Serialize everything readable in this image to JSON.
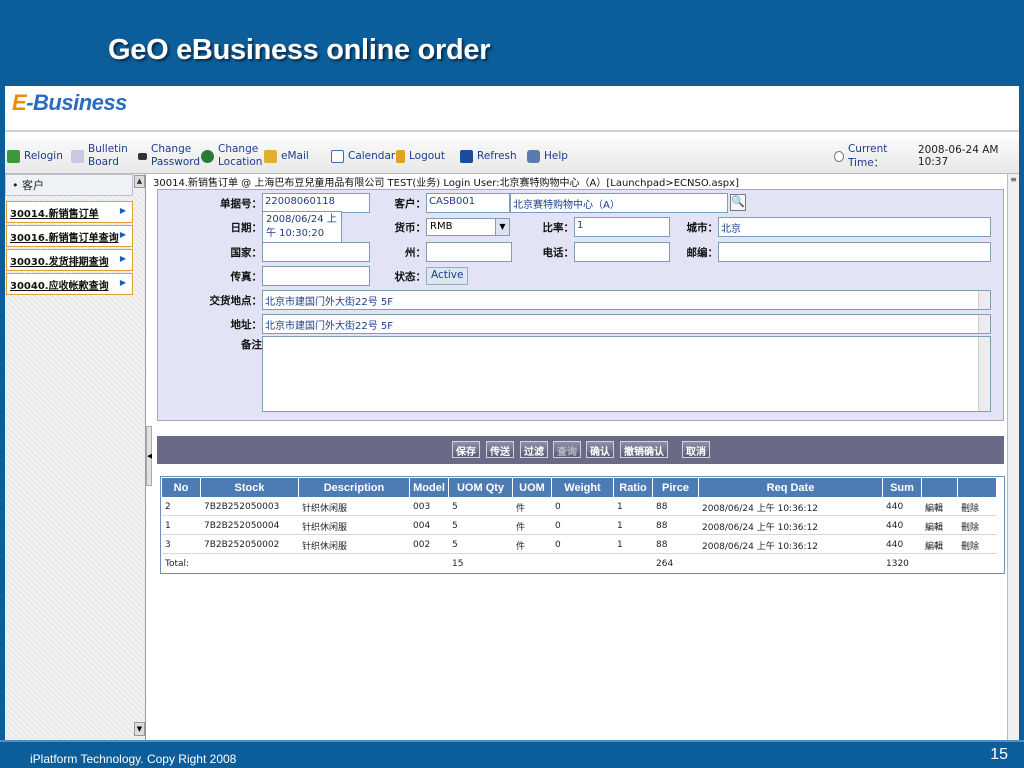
{
  "slide": {
    "title": "GeO eBusiness online order",
    "footer": "iPlatform Technology. Copy Right  2008",
    "page_number": "15"
  },
  "brand": {
    "logo_prefix": "E",
    "logo_suffix": "-Business"
  },
  "toolbar": {
    "relogin": "Relogin",
    "bulletin_1": "Bulletin",
    "bulletin_2": "Board",
    "change_password_1": "Change",
    "change_password_2": "Password",
    "change_location_1": "Change",
    "change_location_2": "Location",
    "email": "eMail",
    "calendar": "Calendar",
    "logout": "Logout",
    "refresh": "Refresh",
    "help": "Help",
    "current_time_label": "Current Time：",
    "current_time": "2008-06-24 AM 10:37"
  },
  "sidebar": {
    "header": "• 客户",
    "items": [
      {
        "label": "30014.新销售订单"
      },
      {
        "label": "30016.新销售订单查询"
      },
      {
        "label": "30030.发货排期查询"
      },
      {
        "label": "30040.应收帐款查询"
      }
    ]
  },
  "breadcrumb": "30014.新销售订单 @ 上海巴布豆兒童用品有限公司 TEST(业务) Login User:北京赛特购物中心（A）[Launchpad>ECNSO.aspx]",
  "form": {
    "order_no_label": "单据号：",
    "order_no": "22008060118",
    "customer_label": "客户：",
    "customer_code": "CASB001",
    "customer_name": "北京赛特购物中心（A）",
    "date_label": "日期：",
    "date_line1": "2008/06/24 上",
    "date_line2": "午 10:30:20",
    "currency_label": "货币：",
    "currency": "RMB",
    "rate_label": "比率：",
    "rate": "1",
    "city_label": "城市：",
    "city": "北京",
    "country_label": "国家：",
    "country": "",
    "state_label": "州：",
    "state": "",
    "phone_label": "电话：",
    "phone": "",
    "zip_label": "邮编：",
    "zip": "",
    "fax_label": "传真：",
    "fax": "",
    "status_label": "状态：",
    "status": "Active",
    "delivery_label": "交货地点：",
    "delivery": "北京市建国门外大街22号 5F",
    "address_label": "地址：",
    "address": "北京市建国门外大街22号 5F",
    "remark_label": "备注",
    "remark": ""
  },
  "actions": {
    "save": "保存",
    "send": "传送",
    "filter": "过滤",
    "query": "查询",
    "confirm": "确认",
    "cancel_confirm": "撤销确认",
    "cancel": "取消"
  },
  "table": {
    "headers": [
      "No",
      "Stock",
      "Description",
      "Model",
      "UOM Qty",
      "UOM",
      "Weight",
      "Ratio",
      "Pirce",
      "Req Date",
      "Sum",
      "",
      ""
    ],
    "rows": [
      [
        "2",
        "7B2B252050003",
        "针织休闲服",
        "003",
        "5",
        "件",
        "0",
        "1",
        "88",
        "2008/06/24 上午 10:36:12",
        "440",
        "編輯",
        "刪除"
      ],
      [
        "1",
        "7B2B252050004",
        "针织休闲服",
        "004",
        "5",
        "件",
        "0",
        "1",
        "88",
        "2008/06/24 上午 10:36:12",
        "440",
        "編輯",
        "刪除"
      ],
      [
        "3",
        "7B2B252050002",
        "针织休闲服",
        "002",
        "5",
        "件",
        "0",
        "1",
        "88",
        "2008/06/24 上午 10:36:12",
        "440",
        "編輯",
        "刪除"
      ],
      [
        "Total:",
        "",
        "",
        "",
        "15",
        "",
        "",
        "",
        "264",
        "",
        "1320",
        "",
        ""
      ]
    ]
  },
  "colors": {
    "slide_blue": "#0b5e99",
    "form_bg": "#e3e3f6",
    "grid_header": "#4d7bb3",
    "action_bar": "#6a6a86"
  }
}
